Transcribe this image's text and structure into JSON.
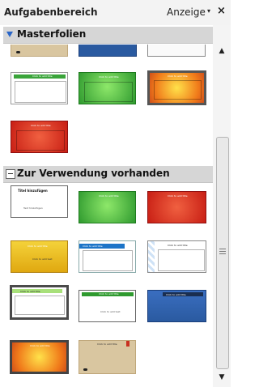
{
  "panel": {
    "title": "Aufgabenbereich",
    "view_menu": "Anzeige",
    "close_label": "×",
    "dropdown_glyph": "▾"
  },
  "sections": [
    {
      "label": "Masterfolien",
      "state": "expanded"
    },
    {
      "label": "Zur Verwendung vorhanden",
      "state": "collapsed-toggle"
    }
  ],
  "thumbs": {
    "heading": "Click to add title",
    "body": "Click to add text",
    "tiny_title": "Titel hinzufügen",
    "tiny_body": "Text hinzufügen"
  },
  "scrollbar": {
    "up_glyph": "▲",
    "down_glyph": "▼"
  },
  "colors": {
    "accent": "#2a66c8",
    "green": "#3aa43a",
    "red": "#d22a1e",
    "blue": "#2a5aa0"
  }
}
